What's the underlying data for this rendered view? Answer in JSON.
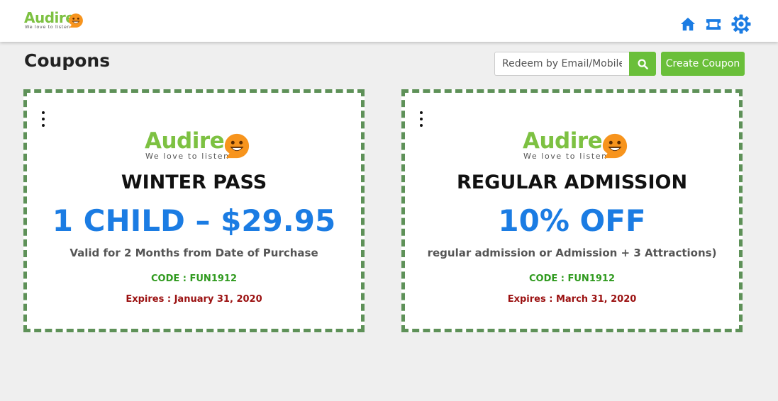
{
  "brand": {
    "name": "Audire",
    "tagline": "We love to listen",
    "green": "#7dc142",
    "orange": "#f7941d"
  },
  "header": {
    "icons": [
      "home-icon",
      "ticket-icon",
      "gear-icon"
    ],
    "accent": "#1b7ce3"
  },
  "page": {
    "title": "Coupons"
  },
  "redeem": {
    "placeholder": "Redeem by Email/Mobile...",
    "value": ""
  },
  "actions": {
    "create_label": "Create Coupon"
  },
  "coupons": [
    {
      "title": "WINTER PASS",
      "offer": "1 CHILD – $29.95",
      "description": "Valid for 2 Months from Date of Purchase",
      "code": "CODE : FUN1912",
      "expires": "Expires : January 31, 2020"
    },
    {
      "title": "REGULAR ADMISSION",
      "offer": "10% OFF",
      "description": "regular admission or Admission + 3 Attractions)",
      "code": "CODE : FUN1912",
      "expires": "Expires : March 31, 2020"
    }
  ]
}
